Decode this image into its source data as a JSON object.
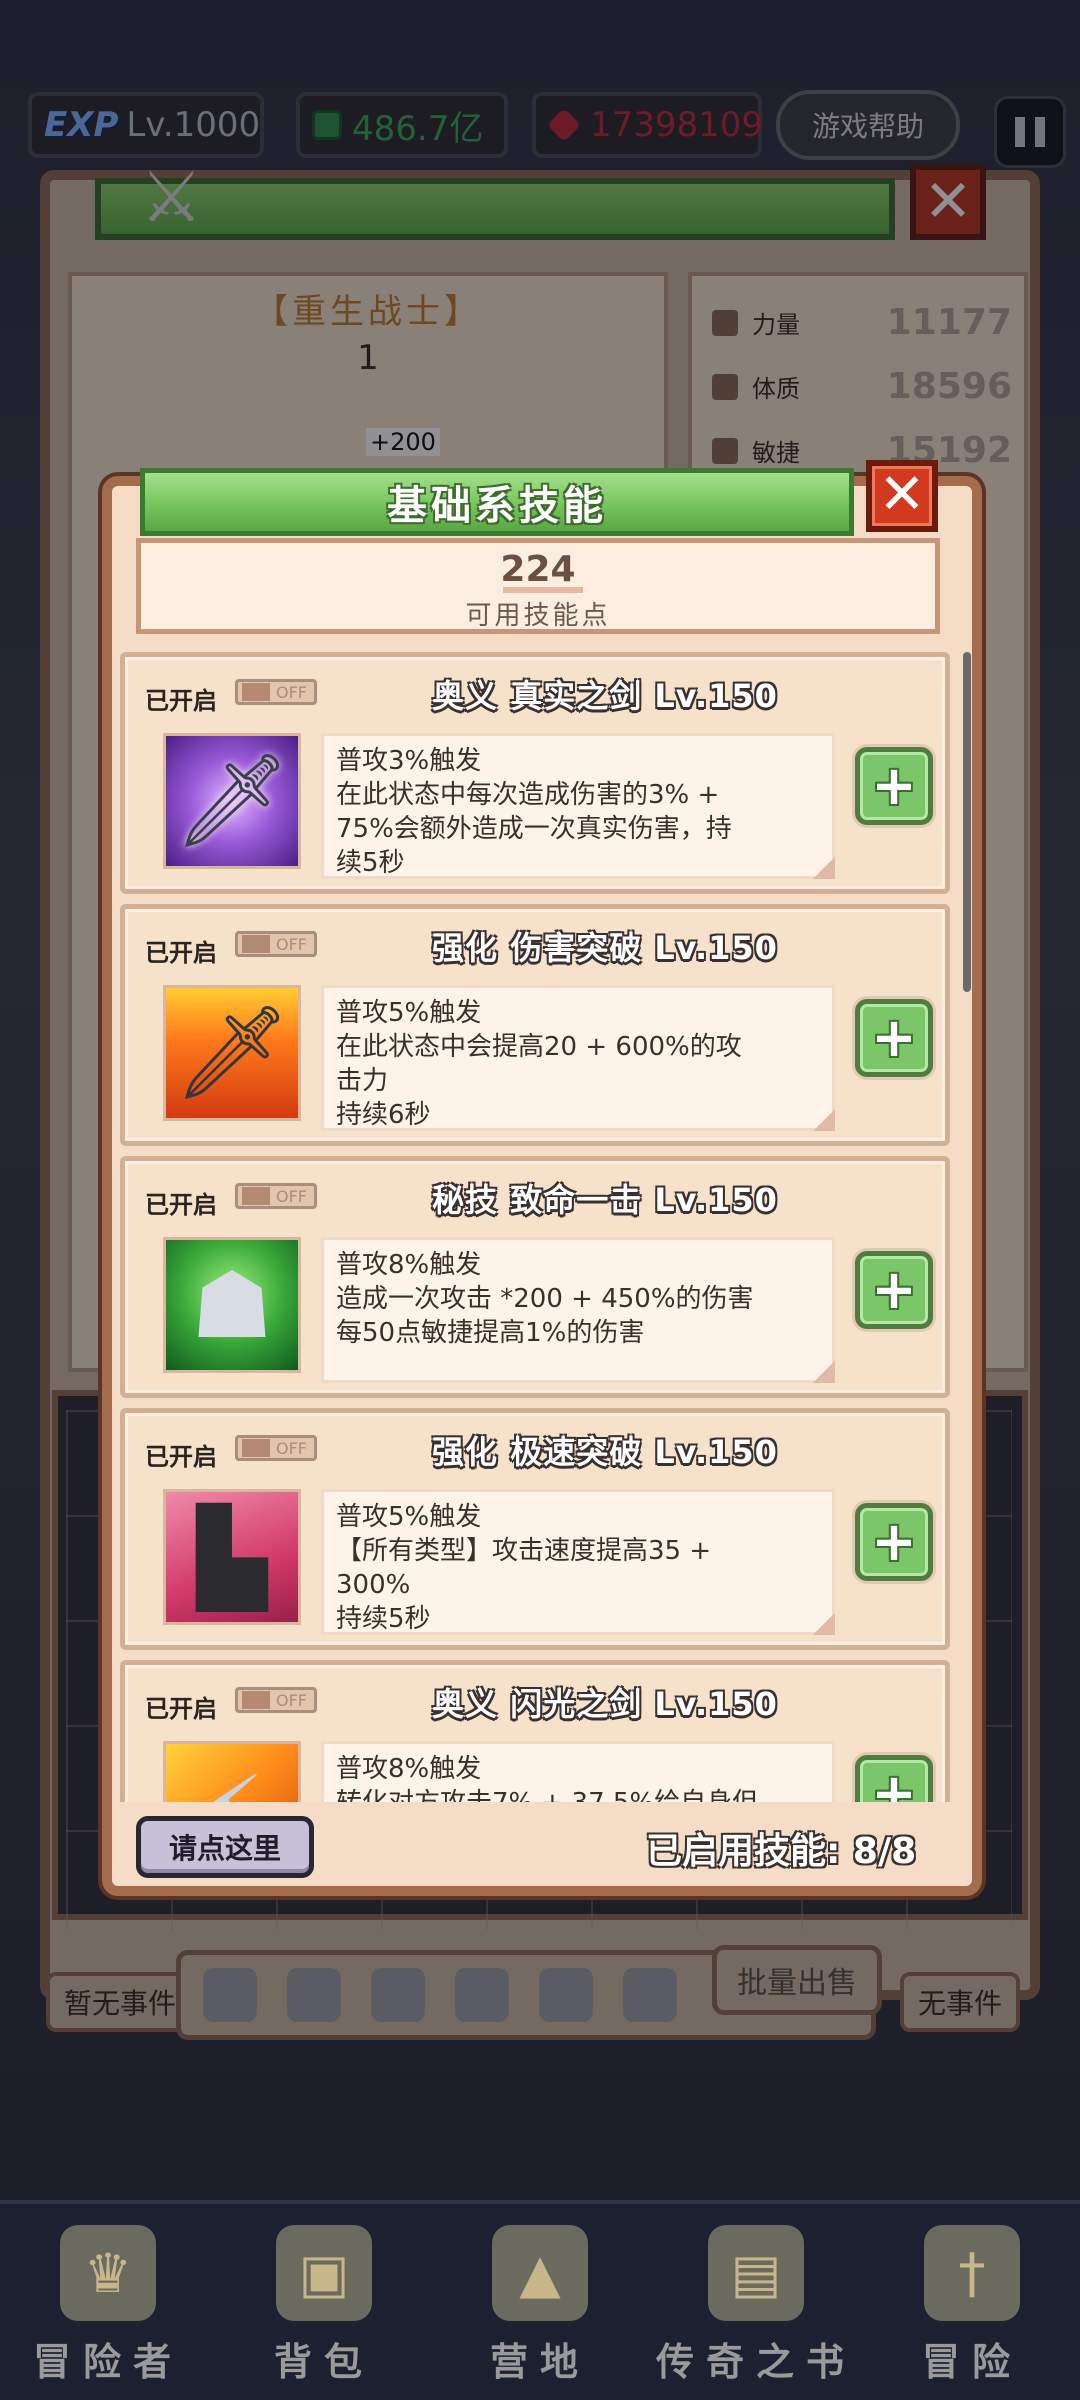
{
  "hud": {
    "exp_badge": "EXP",
    "level": "Lv.1000",
    "gold": "486.7亿",
    "gems": "17398109",
    "help_label": "游戏帮助"
  },
  "background": {
    "class_name": "【重生战士】",
    "class_level": "1",
    "badge": "+200",
    "stats": [
      {
        "label": "力量",
        "value": "11177"
      },
      {
        "label": "体质",
        "value": "18596"
      },
      {
        "label": "敏捷",
        "value": "15192"
      }
    ],
    "event_left": "暂无事件",
    "event_right": "无事件",
    "bulk_sell": "批量出售"
  },
  "modal": {
    "title": "基础系技能",
    "points": "224",
    "points_label": "可用技能点",
    "footer_button": "请点这里",
    "enabled_count": "已启用技能: 8/8",
    "skills": [
      {
        "status": "已开启",
        "toggle": "OFF",
        "name": "奥义 真实之剑 Lv.150",
        "icon": "sword-icon",
        "desc": [
          "普攻3%触发",
          "在此状态中每次造成伤害的3% +",
          "75%会额外造成一次真实伤害，持",
          "续5秒"
        ]
      },
      {
        "status": "已开启",
        "toggle": "OFF",
        "name": "强化 伤害突破 Lv.150",
        "icon": "flaming-sword-icon",
        "desc": [
          "普攻5%触发",
          "在此状态中会提高20 + 600%的攻",
          "击力",
          "持续6秒"
        ]
      },
      {
        "status": "已开启",
        "toggle": "OFF",
        "name": "秘技 致命一击 Lv.150",
        "icon": "assassin-icon",
        "desc": [
          "普攻8%触发",
          "造成一次攻击 *200 + 450%的伤害",
          "每50点敏捷提高1%的伤害",
          ""
        ]
      },
      {
        "status": "已开启",
        "toggle": "OFF",
        "name": "强化 极速突破 Lv.150",
        "icon": "boot-icon",
        "desc": [
          "普攻5%触发",
          "【所有类型】攻击速度提高35 +",
          "300%",
          "持续5秒"
        ]
      },
      {
        "status": "已开启",
        "toggle": "OFF",
        "name": "奥义 闪光之剑 Lv.150",
        "icon": "flash-sword-icon",
        "desc": [
          "普攻8%触发",
          "转化对方攻击7% + 37.5%给自身但",
          "",
          ""
        ]
      }
    ]
  },
  "nav": [
    {
      "label": "冒险者",
      "icon": "crown-icon"
    },
    {
      "label": "背包",
      "icon": "bag-icon"
    },
    {
      "label": "营地",
      "icon": "camp-icon"
    },
    {
      "label": "传奇之书",
      "icon": "book-icon"
    },
    {
      "label": "冒险",
      "icon": "adventure-sword-icon"
    }
  ]
}
